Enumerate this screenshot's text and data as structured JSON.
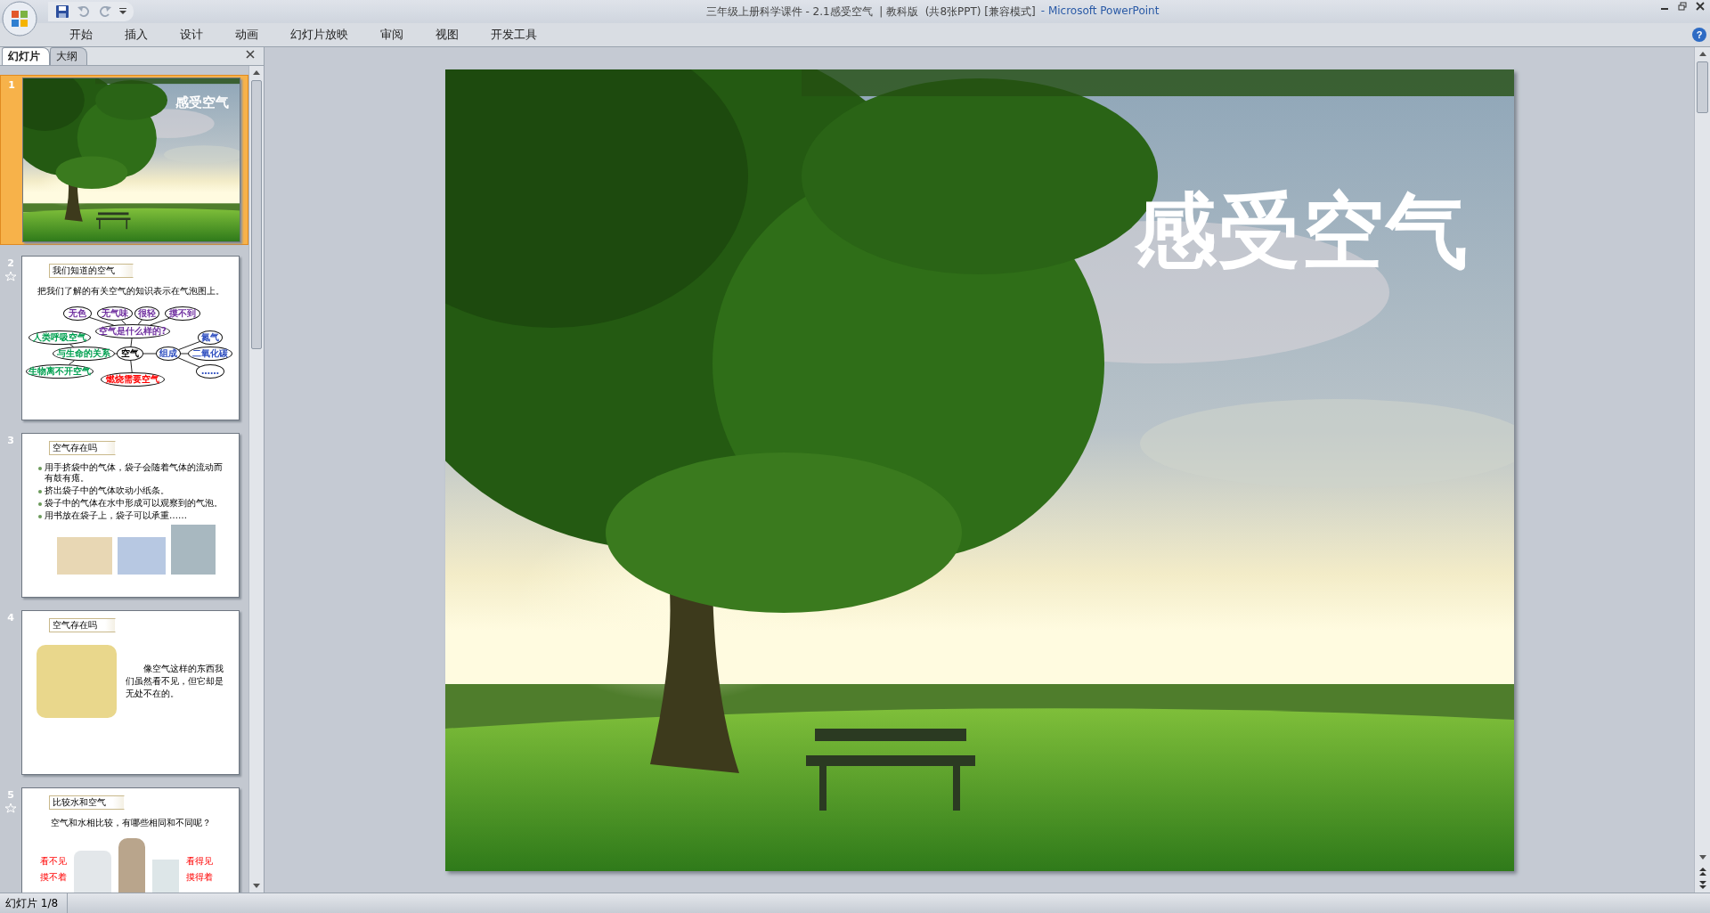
{
  "window": {
    "title": "三年级上册科学课件 - 2.1感受空气  | 教科版  (共8张PPT) [兼容模式]",
    "app_name": "- Microsoft PowerPoint"
  },
  "help_button": "?",
  "ribbon_tabs": [
    "开始",
    "插入",
    "设计",
    "动画",
    "幻灯片放映",
    "审阅",
    "视图",
    "开发工具"
  ],
  "pane_tabs": [
    {
      "label": "幻灯片",
      "selected": true
    },
    {
      "label": "大纲",
      "selected": false
    }
  ],
  "slides": [
    {
      "number": "1",
      "selected": true,
      "animated": false,
      "kind": "title",
      "title": "感受空气"
    },
    {
      "number": "2",
      "selected": false,
      "animated": true,
      "kind": "bubble_map",
      "heading": "我们知道的空气",
      "instruction": "把我们了解的有关空气的知识表示在气泡图上。",
      "root": {
        "text": "空气",
        "color": "#000000",
        "children": [
          {
            "text": "空气是什么样的?",
            "color": "#7030a0",
            "children": [
              {
                "text": "无色",
                "color": "#7030a0"
              },
              {
                "text": "无气味",
                "color": "#7030a0"
              },
              {
                "text": "很轻",
                "color": "#7030a0"
              },
              {
                "text": "摸不到",
                "color": "#7030a0"
              }
            ]
          },
          {
            "text": "与生命的关系",
            "color": "#00a050",
            "children": [
              {
                "text": "人类呼吸空气",
                "color": "#00a050"
              },
              {
                "text": "生物离不开空气",
                "color": "#00a050"
              }
            ]
          },
          {
            "text": "组成",
            "color": "#3050c0",
            "children": [
              {
                "text": "氮气",
                "color": "#3050c0"
              },
              {
                "text": "二氧化碳",
                "color": "#3050c0"
              },
              {
                "text": "……",
                "color": "#3050c0"
              }
            ]
          },
          {
            "text": "燃烧需要空气",
            "color": "#ff0000"
          }
        ]
      }
    },
    {
      "number": "3",
      "selected": false,
      "animated": false,
      "kind": "bullets",
      "heading": "空气存在吗",
      "bullets": [
        "用手挤袋中的气体，袋子会随着气体的流动而有鼓有瘪。",
        "挤出袋子中的气体吹动小纸条。",
        "袋子中的气体在水中形成可以观察到的气泡。",
        "用书放在袋子上，袋子可以承重……"
      ]
    },
    {
      "number": "4",
      "selected": false,
      "animated": false,
      "kind": "picture_text",
      "heading": "空气存在吗",
      "text": "像空气这样的东西我们虽然看不见，但它却是无处不在的。"
    },
    {
      "number": "5",
      "selected": false,
      "animated": true,
      "kind": "compare",
      "heading": "比较水和空气",
      "question": "空气和水相比较，有哪些相同和不同呢？",
      "left_lines": [
        "看不见",
        "摸不着"
      ],
      "right_lines": [
        "看得见",
        "摸得着"
      ]
    }
  ],
  "main_slide": {
    "title": "感受空气"
  },
  "status_bar": {
    "slide_indicator": "幻灯片 1/8"
  }
}
